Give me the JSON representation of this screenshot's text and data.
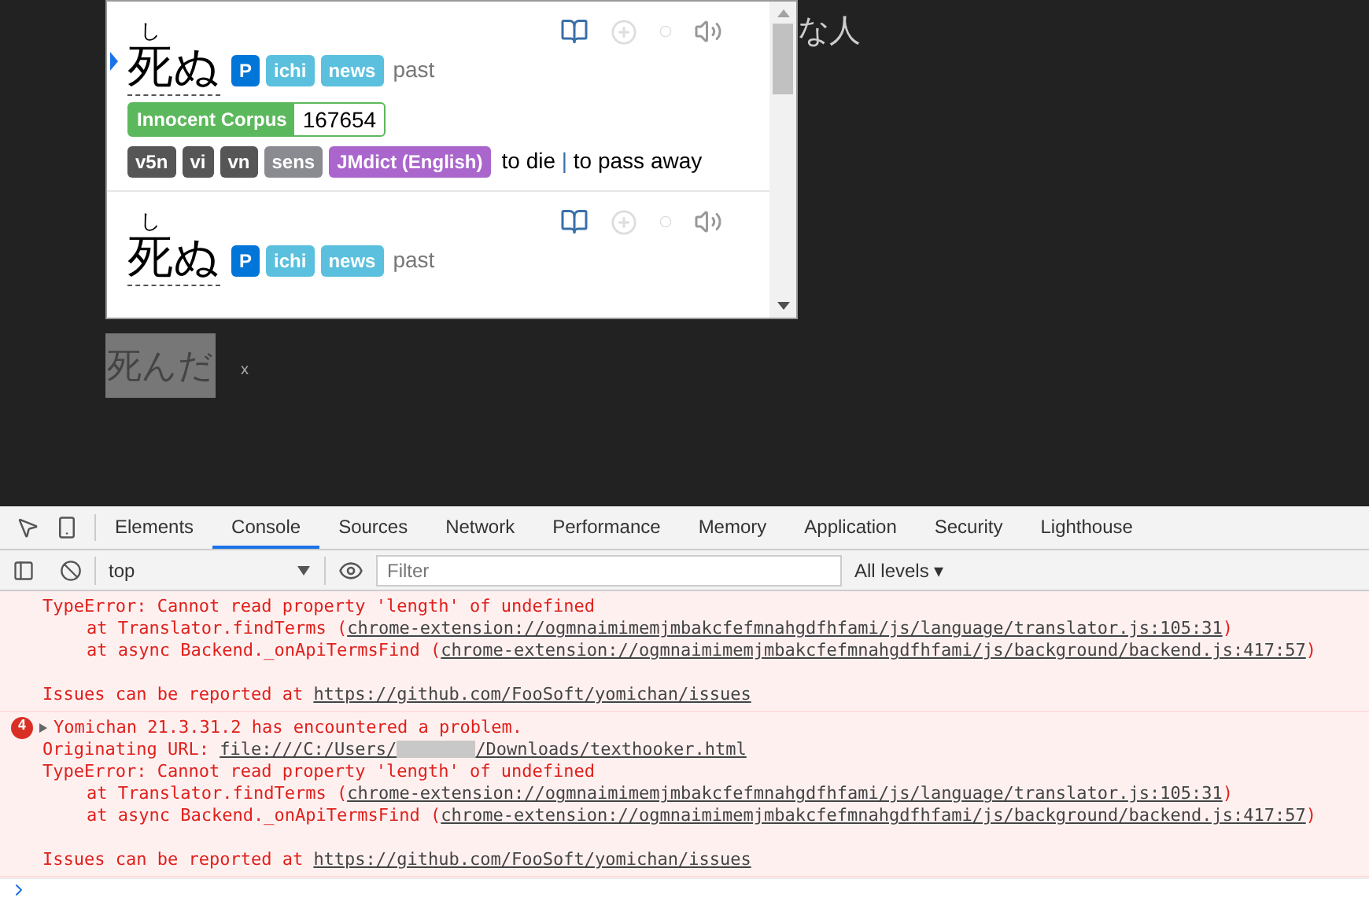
{
  "page": {
    "background_text": "な人",
    "selected_text": "死んだ",
    "close_mark": "x"
  },
  "popup": {
    "entries": [
      {
        "selected": true,
        "reading": "し",
        "expression": "死ぬ",
        "tags": [
          {
            "label": "P",
            "color": "#0275d8"
          },
          {
            "label": "ichi",
            "color": "#5bc0de"
          },
          {
            "label": "news",
            "color": "#5bc0de"
          }
        ],
        "inflection": "past",
        "frequency": {
          "dictionary": "Innocent Corpus",
          "value": "167654"
        },
        "sense": {
          "tags": [
            {
              "label": "v5n",
              "color": "#565656"
            },
            {
              "label": "vi",
              "color": "#565656"
            },
            {
              "label": "vn",
              "color": "#565656"
            },
            {
              "label": "sens",
              "color": "#8a8a91"
            },
            {
              "label": "JMdict (English)",
              "color": "#aa66cc"
            }
          ],
          "glosses": [
            "to die",
            "to pass away"
          ],
          "separator": "|"
        }
      },
      {
        "selected": false,
        "reading": "し",
        "expression": "死ぬ",
        "tags": [
          {
            "label": "P",
            "color": "#0275d8"
          },
          {
            "label": "ichi",
            "color": "#5bc0de"
          },
          {
            "label": "news",
            "color": "#5bc0de"
          }
        ],
        "inflection": "past"
      }
    ]
  },
  "devtools": {
    "tabs": [
      {
        "label": "Elements",
        "selected": false
      },
      {
        "label": "Console",
        "selected": true
      },
      {
        "label": "Sources",
        "selected": false
      },
      {
        "label": "Network",
        "selected": false
      },
      {
        "label": "Performance",
        "selected": false
      },
      {
        "label": "Memory",
        "selected": false
      },
      {
        "label": "Application",
        "selected": false
      },
      {
        "label": "Security",
        "selected": false
      },
      {
        "label": "Lighthouse",
        "selected": false
      }
    ],
    "context": "top",
    "filter_placeholder": "Filter",
    "levels": "All levels ▾",
    "messages": [
      {
        "lines": [
          {
            "kind": "error",
            "parts": [
              {
                "kind": "text",
                "text": "TypeError: Cannot read property 'length' of undefined"
              }
            ]
          },
          {
            "kind": "stack",
            "parts": [
              {
                "kind": "text",
                "text": "at Translator.findTerms ("
              },
              {
                "kind": "link",
                "text": "chrome-extension://ogmnaimimemjmbakcfefmnahgdfhfami/js/language/translator.js:105:31"
              },
              {
                "kind": "text",
                "text": ")"
              }
            ]
          },
          {
            "kind": "stack",
            "parts": [
              {
                "kind": "text",
                "text": "at async Backend._onApiTermsFind ("
              },
              {
                "kind": "link",
                "text": "chrome-extension://ogmnaimimemjmbakcfefmnahgdfhfami/js/background/backend.js:417:57"
              },
              {
                "kind": "text",
                "text": ")"
              }
            ]
          },
          {
            "kind": "blank"
          },
          {
            "kind": "error",
            "parts": [
              {
                "kind": "text",
                "text": "Issues can be reported at "
              },
              {
                "kind": "link",
                "text": "https://github.com/FooSoft/yomichan/issues"
              }
            ]
          }
        ]
      },
      {
        "count": "4",
        "expanded": false,
        "title": "Yomichan 21.3.31.2 has encountered a problem.",
        "lines": [
          {
            "kind": "error",
            "parts": [
              {
                "kind": "text",
                "text": "Originating URL: "
              },
              {
                "kind": "link",
                "text": "file:///C:/Users/"
              },
              {
                "kind": "redacted"
              },
              {
                "kind": "link",
                "text": "/Downloads/texthooker.html"
              }
            ]
          },
          {
            "kind": "error",
            "parts": [
              {
                "kind": "text",
                "text": "TypeError: Cannot read property 'length' of undefined"
              }
            ]
          },
          {
            "kind": "stack",
            "parts": [
              {
                "kind": "text",
                "text": "at Translator.findTerms ("
              },
              {
                "kind": "link",
                "text": "chrome-extension://ogmnaimimemjmbakcfefmnahgdfhfami/js/language/translator.js:105:31"
              },
              {
                "kind": "text",
                "text": ")"
              }
            ]
          },
          {
            "kind": "stack",
            "parts": [
              {
                "kind": "text",
                "text": "at async Backend._onApiTermsFind ("
              },
              {
                "kind": "link",
                "text": "chrome-extension://ogmnaimimemjmbakcfefmnahgdfhfami/js/background/backend.js:417:57"
              },
              {
                "kind": "text",
                "text": ")"
              }
            ]
          },
          {
            "kind": "blank"
          },
          {
            "kind": "error",
            "parts": [
              {
                "kind": "text",
                "text": "Issues can be reported at "
              },
              {
                "kind": "link",
                "text": "https://github.com/FooSoft/yomichan/issues"
              }
            ]
          }
        ]
      }
    ]
  }
}
